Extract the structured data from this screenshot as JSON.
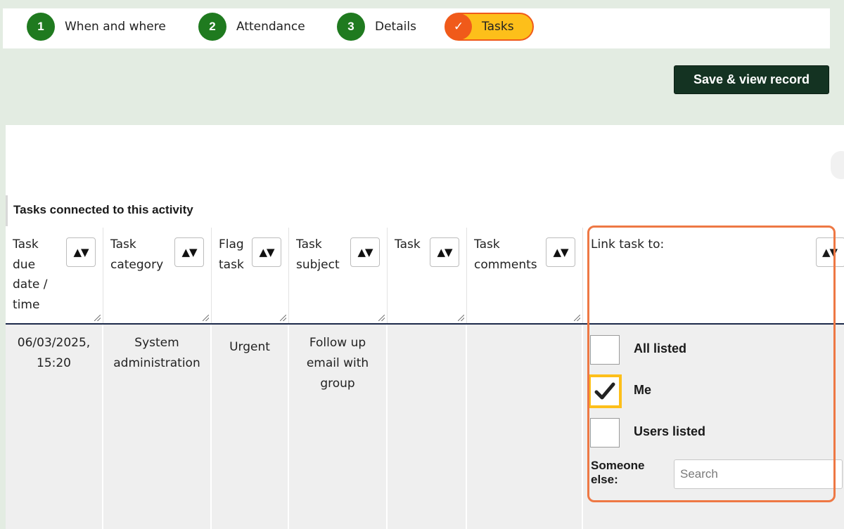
{
  "stepper": {
    "steps": [
      {
        "number": "1",
        "label": "When and where"
      },
      {
        "number": "2",
        "label": "Attendance"
      },
      {
        "number": "3",
        "label": "Details"
      }
    ],
    "active": {
      "icon": "check-icon",
      "glyph": "✓",
      "label": "Tasks"
    }
  },
  "actions": {
    "save_label": "Save & view record"
  },
  "table": {
    "caption": "Tasks connected to this activity",
    "sort_glyph": "▲▼",
    "columns": [
      {
        "label": "Task due date / time"
      },
      {
        "label": "Task category"
      },
      {
        "label": "Flag task"
      },
      {
        "label": "Task subject"
      },
      {
        "label": "Task"
      },
      {
        "label": "Task comments"
      }
    ],
    "row": {
      "due": "06/03/2025, 15:20",
      "category": "System administration",
      "flag": "Urgent",
      "subject": "Follow up email with group",
      "task": "",
      "comments": ""
    }
  },
  "link_task": {
    "header": "Link task to:",
    "options": [
      {
        "label": "All listed",
        "checked": false
      },
      {
        "label": "Me",
        "checked": true
      },
      {
        "label": "Users listed",
        "checked": false
      }
    ],
    "someone_label": "Someone else:",
    "search_placeholder": "Search"
  },
  "colors": {
    "step_green": "#1f7a1f",
    "active_fill": "#fdbf1a",
    "active_border": "#f05a1a",
    "save_button": "#143322",
    "highlight_border": "#ee7844",
    "page_bg": "#e3ece2"
  }
}
